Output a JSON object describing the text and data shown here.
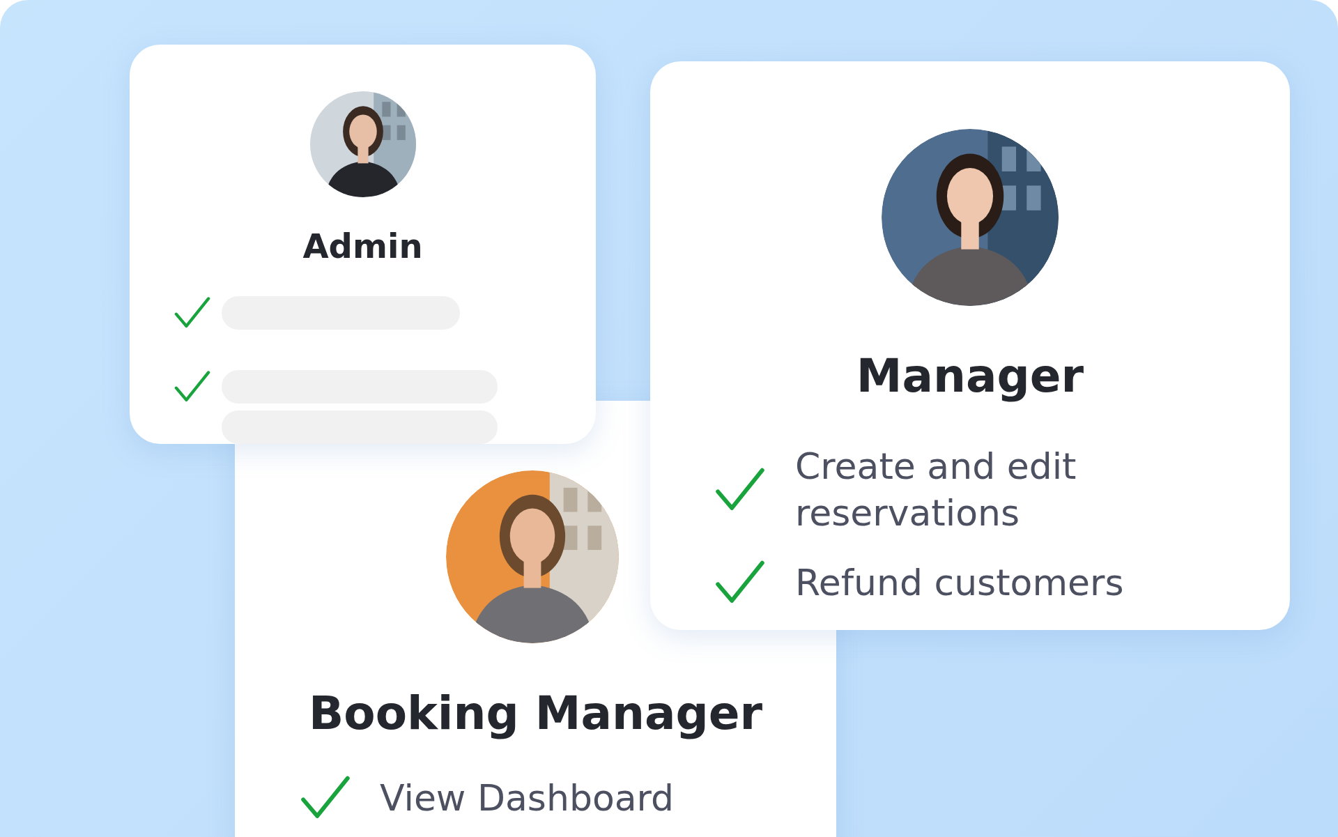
{
  "cards": [
    {
      "title": "Admin",
      "avatar": {
        "kind": "picture"
      },
      "permissions": [
        {
          "kind": "skeleton",
          "checked": true
        },
        {
          "kind": "skeleton",
          "checked": true
        },
        {
          "kind": "skeleton",
          "checked": false
        }
      ]
    },
    {
      "title": "Manager",
      "avatar": {
        "kind": "picture"
      },
      "permissions": [
        {
          "kind": "text",
          "label": "Create and edit reservations",
          "checked": true
        },
        {
          "kind": "text",
          "label": "Refund customers",
          "checked": true
        }
      ]
    },
    {
      "title": "Booking Manager",
      "avatar": {
        "kind": "picture"
      },
      "permissions": [
        {
          "kind": "text",
          "label": "View Dashboard",
          "checked": true
        }
      ]
    }
  ]
}
